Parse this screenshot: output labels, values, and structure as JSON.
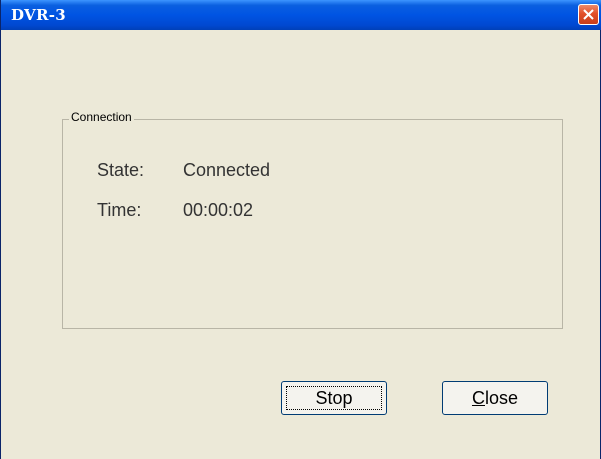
{
  "window": {
    "title": "DVR-3"
  },
  "connection": {
    "group_title": "Connection",
    "state_label": "State:",
    "state_value": "Connected",
    "time_label": "Time:",
    "time_value": "00:00:02"
  },
  "buttons": {
    "stop": "Stop",
    "close_first": "C",
    "close_rest": "lose"
  },
  "icons": {
    "title_close": "close-icon"
  }
}
